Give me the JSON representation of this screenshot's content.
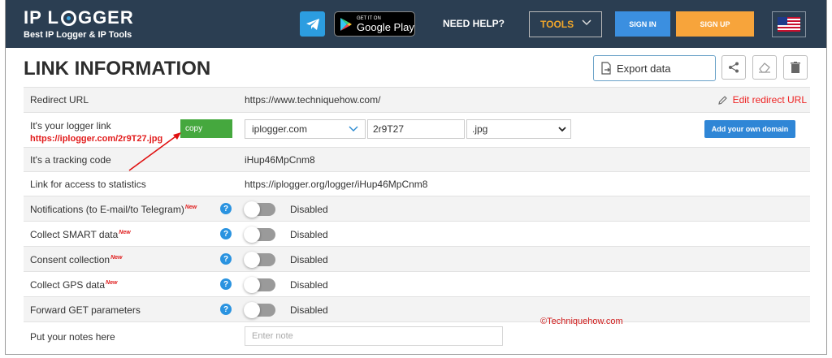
{
  "header": {
    "logo_main_left": "IP L",
    "logo_main_right": "GGER",
    "logo_sub": "Best IP Logger & IP Tools",
    "google_play_small": "GET IT ON",
    "google_play_big": "Google Play",
    "need_help": "NEED HELP?",
    "tools": "TOOLS",
    "sign_in": "SIGN IN",
    "sign_up": "SIGN UP"
  },
  "page": {
    "title": "LINK INFORMATION",
    "export_label": "Export data"
  },
  "rows": {
    "redirect": {
      "label": "Redirect URL",
      "value": "https://www.techniquehow.com/",
      "edit": "Edit redirect URL"
    },
    "logger": {
      "label": "It's your logger link",
      "link": "https://iplogger.com/2r9T27.jpg",
      "copy": "copy",
      "domain": "iplogger.com",
      "code": "2r9T27",
      "ext": ".jpg",
      "add_domain": "Add your own domain"
    },
    "tracking": {
      "label": "It's a tracking code",
      "value": "iHup46MpCnm8"
    },
    "stats": {
      "label": "Link for access to statistics",
      "value": "https://iplogger.org/logger/iHup46MpCnm8"
    },
    "notifications": {
      "label": "Notifications (to E-mail/to Telegram)",
      "badge": "New",
      "status": "Disabled"
    },
    "smart": {
      "label": "Collect SMART data",
      "badge": "New",
      "status": "Disabled"
    },
    "consent": {
      "label": "Consent collection",
      "badge": "New",
      "status": "Disabled"
    },
    "gps": {
      "label": "Collect GPS data",
      "badge": "New",
      "status": "Disabled"
    },
    "forward": {
      "label": "Forward GET parameters",
      "status": "Disabled"
    },
    "notes": {
      "label": "Put your notes here",
      "placeholder": "Enter note"
    }
  },
  "help_symbol": "?",
  "watermark": "©Techniquehow.com",
  "colors": {
    "header_bg": "#2b3e52",
    "accent_blue": "#2f86d6",
    "accent_orange": "#f7a43b",
    "link_red": "#e21c1c",
    "copy_green": "#45a83e"
  }
}
